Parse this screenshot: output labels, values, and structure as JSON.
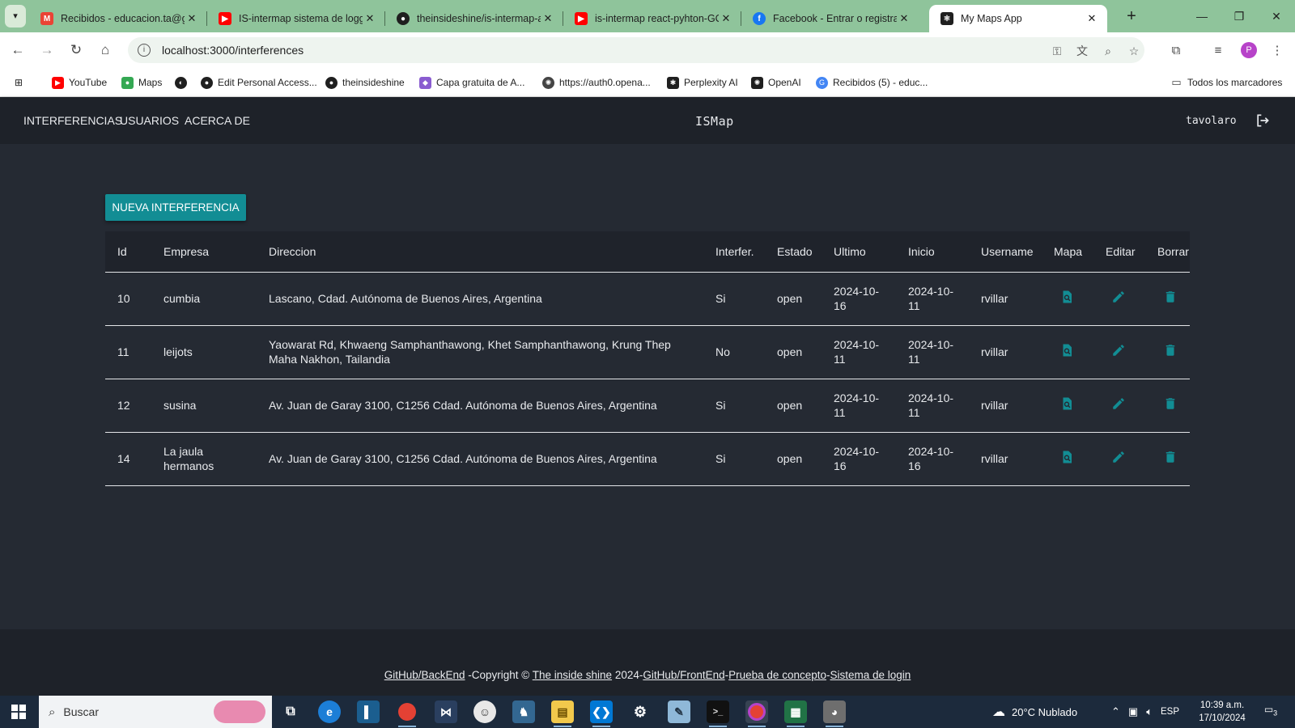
{
  "browser": {
    "tabs": [
      {
        "title": "Recibidos - educacion.ta@gm",
        "icon": "gmail-icon",
        "color": "#ea4335"
      },
      {
        "title": "IS-intermap sistema de logg",
        "icon": "youtube-icon",
        "color": "#ff0000"
      },
      {
        "title": "theinsideshine/is-intermap-a",
        "icon": "github-icon",
        "color": "#1f1f1f"
      },
      {
        "title": "is-intermap react-pyhton-GC",
        "icon": "youtube-icon",
        "color": "#ff0000"
      },
      {
        "title": "Facebook - Entrar o registrar",
        "icon": "facebook-icon",
        "color": "#1877f2"
      },
      {
        "title": "My Maps App",
        "icon": "react-icon",
        "color": "#1f1f1f"
      }
    ],
    "url": "localhost:3000/interferences",
    "bookmarks": [
      {
        "label": "YouTube",
        "icon": "youtube-icon",
        "color": "#ff0000"
      },
      {
        "label": "Maps",
        "icon": "maps-icon",
        "color": "#34a853"
      },
      {
        "label": "",
        "icon": "shield-icon",
        "color": "#1f1f1f"
      },
      {
        "label": "Edit Personal Access...",
        "icon": "github-icon",
        "color": "#1f1f1f"
      },
      {
        "label": "theinsideshine",
        "icon": "github-icon",
        "color": "#1f1f1f"
      },
      {
        "label": "Capa gratuita de A...",
        "icon": "cube-icon",
        "color": "#8a5cd0"
      },
      {
        "label": "https://auth0.opena...",
        "icon": "openai-icon",
        "color": "#444444"
      },
      {
        "label": "Perplexity AI",
        "icon": "perplexity-icon",
        "color": "#1f1f1f"
      },
      {
        "label": "OpenAI",
        "icon": "openai-icon",
        "color": "#1f1f1f"
      },
      {
        "label": "Recibidos (5) - educ...",
        "icon": "google-icon",
        "color": "#4285f4"
      }
    ],
    "all_bookmarks": "Todos los marcadores",
    "profile_initial": "P"
  },
  "navbar": {
    "links": [
      "INTERFERENCIAS",
      "USUARIOS",
      "ACERCA DE"
    ],
    "brand": "ISMap",
    "username": "tavolaro"
  },
  "page": {
    "new_button": "NUEVA INTERFERENCIA",
    "columns": [
      "Id",
      "Empresa",
      "Direccion",
      "Interfer.",
      "Estado",
      "Ultimo",
      "Inicio",
      "Username",
      "Mapa",
      "Editar",
      "Borrar"
    ],
    "rows": [
      {
        "id": "10",
        "empresa": "cumbia",
        "direccion": "Lascano, Cdad. Autónoma de Buenos Aires, Argentina",
        "interfer": "Si",
        "estado": "open",
        "ultimo": "2024-10-16",
        "inicio": "2024-10-11",
        "username": "rvillar"
      },
      {
        "id": "11",
        "empresa": "leijots",
        "direccion": "Yaowarat Rd, Khwaeng Samphanthawong, Khet Samphanthawong, Krung Thep Maha Nakhon, Tailandia",
        "interfer": "No",
        "estado": "open",
        "ultimo": "2024-10-11",
        "inicio": "2024-10-11",
        "username": "rvillar"
      },
      {
        "id": "12",
        "empresa": "susina",
        "direccion": "Av. Juan de Garay 3100, C1256 Cdad. Autónoma de Buenos Aires, Argentina",
        "interfer": "Si",
        "estado": "open",
        "ultimo": "2024-10-11",
        "inicio": "2024-10-11",
        "username": "rvillar"
      },
      {
        "id": "14",
        "empresa": "La jaula hermanos",
        "direccion": "Av. Juan de Garay 3100, C1256 Cdad. Autónoma de Buenos Aires, Argentina",
        "interfer": "Si",
        "estado": "open",
        "ultimo": "2024-10-16",
        "inicio": "2024-10-16",
        "username": "rvillar"
      }
    ],
    "accent": "#128d94"
  },
  "footer": {
    "backend": "GitHub/BackEnd",
    "copyright": " -Copyright © ",
    "author": "The inside shine",
    "year": " 2024-",
    "frontend": "GitHub/FrontEnd",
    "dash1": "-",
    "poc": "Prueba de concepto",
    "dash2": "-",
    "login": "Sistema de login"
  },
  "taskbar": {
    "search_placeholder": "Buscar",
    "weather": "20°C  Nublado",
    "language": "ESP",
    "time": "10:39 a.m.",
    "date": "17/10/2024",
    "notifications": "3"
  }
}
